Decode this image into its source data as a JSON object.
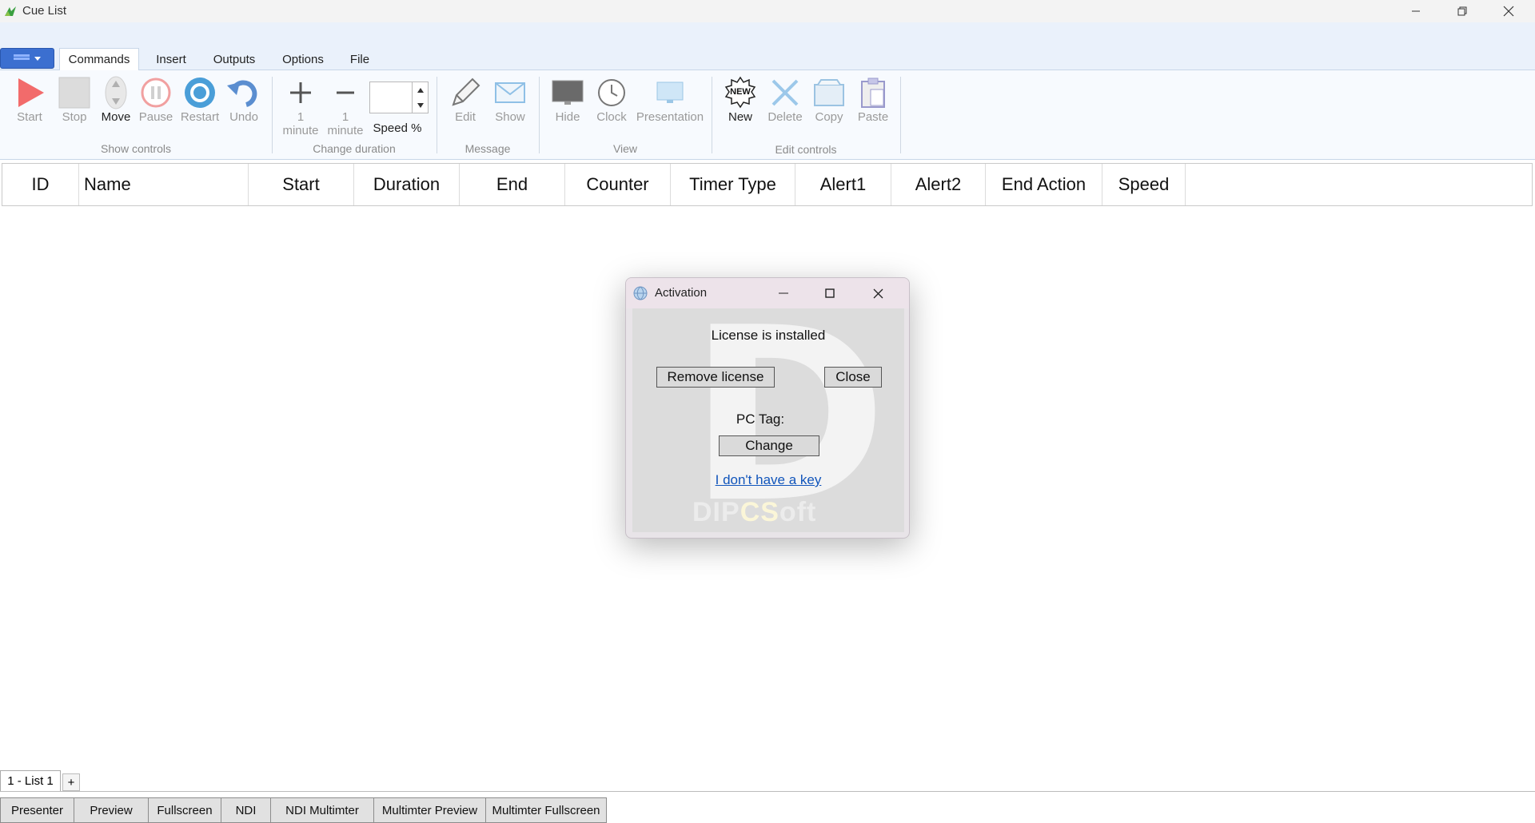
{
  "window": {
    "title": "Cue List"
  },
  "ribbon": {
    "tabs": [
      "Commands",
      "Insert",
      "Outputs",
      "Options",
      "File"
    ],
    "buttons": {
      "start": "Start",
      "stop": "Stop",
      "move": "Move",
      "pause": "Pause",
      "restart": "Restart",
      "undo": "Undo",
      "plus": "1\nminute",
      "minus": "1\nminute",
      "speed": "Speed %",
      "edit": "Edit",
      "show": "Show",
      "hide": "Hide",
      "clock": "Clock",
      "presentation": "Presentation",
      "new": "New",
      "delete": "Delete",
      "copy": "Copy",
      "paste": "Paste"
    },
    "plus_l1": "1",
    "plus_l2": "minute",
    "minus_l1": "1",
    "minus_l2": "minute",
    "groups": {
      "show_controls": "Show controls",
      "change_duration": "Change duration",
      "message": "Message",
      "view": "View",
      "edit_controls": "Edit controls"
    },
    "new_badge": "NEW"
  },
  "grid": {
    "columns": [
      "ID",
      "Name",
      "Start",
      "Duration",
      "End",
      "Counter",
      "Timer Type",
      "Alert1",
      "Alert2",
      "End Action",
      "Speed"
    ]
  },
  "dialog": {
    "title": "Activation",
    "status": "License is installed",
    "remove_label": "Remove license",
    "close_label": "Close",
    "pc_tag_label": "PC Tag:",
    "change_label": "Change",
    "link_label": "I don't have a key",
    "watermark_letter": "D",
    "watermark_text_a": "DIP",
    "watermark_text_b": "CS",
    "watermark_text_c": "oft"
  },
  "sheets": {
    "active": "1 - List 1",
    "add": "+"
  },
  "bottom_tabs": [
    "Presenter",
    "Preview",
    "Fullscreen",
    "NDI",
    "NDI Multimter",
    "Multimter Preview",
    "Multimter Fullscreen"
  ]
}
